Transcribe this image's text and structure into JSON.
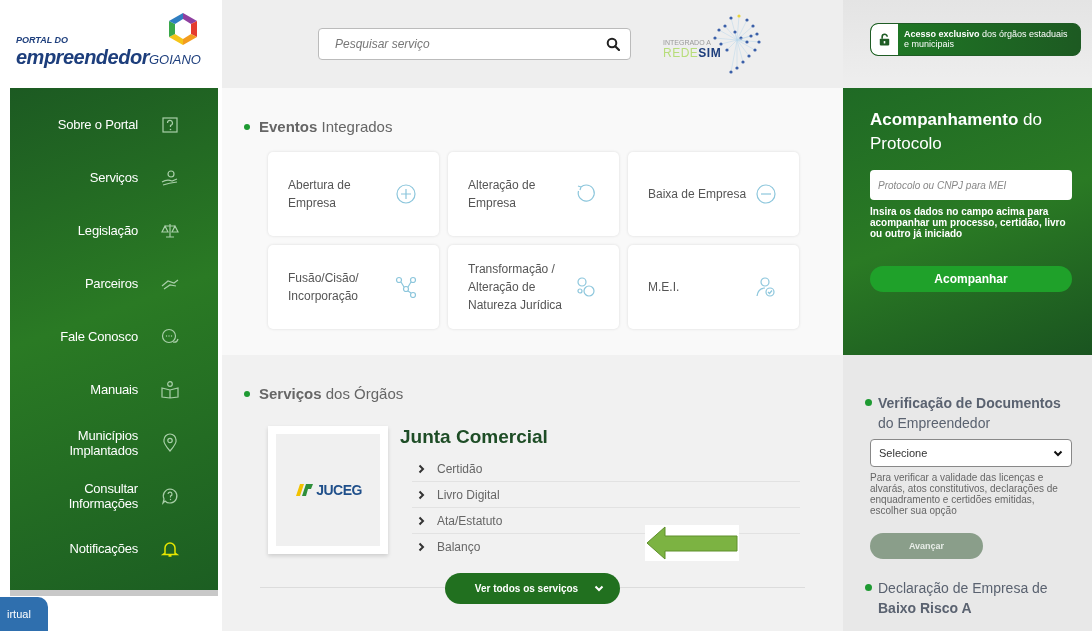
{
  "header": {
    "logo": {
      "top": "PORTAL DO",
      "main": "empreendedor",
      "suffix": "GOIANO"
    },
    "search": {
      "placeholder": "Pesquisar serviço"
    },
    "partner_logo": {
      "caption": "INTEGRADO A",
      "name_light": "REDE",
      "name_bold": "SIM"
    },
    "access_button": "**Acesso exclusivo** dos órgãos estaduais e municipais"
  },
  "sidebar": {
    "items": [
      {
        "label": "Sobre o Portal",
        "highlighted": false
      },
      {
        "label": "Serviços",
        "highlighted": false
      },
      {
        "label": "Legislação",
        "highlighted": false
      },
      {
        "label": "Parceiros",
        "highlighted": false
      },
      {
        "label": "Fale Conosco",
        "highlighted": false
      },
      {
        "label": "Manuais",
        "highlighted": false
      },
      {
        "label": "Municípios Implantados",
        "highlighted": false
      },
      {
        "label": "Consultar Informações",
        "highlighted": false
      },
      {
        "label": "Notificações",
        "highlighted": true
      }
    ]
  },
  "chat_button": "irtual",
  "events": {
    "title": "**Eventos** Integrados",
    "cards": [
      {
        "label": "Abertura de Empresa"
      },
      {
        "label": "Alteração de Empresa"
      },
      {
        "label": "Baixa de Empresa"
      },
      {
        "label": "Fusão/Cisão/ Incorporação"
      },
      {
        "label": "Transformação / Alteração de Natureza Jurídica"
      },
      {
        "label": "M.E.I."
      }
    ]
  },
  "services": {
    "title": "**Serviços** dos Órgãos",
    "organ": {
      "name": "Junta Comercial",
      "logo_text": "JUCEG",
      "links": [
        "Certidão",
        "Livro Digital",
        "Ata/Estatuto",
        "Balanço"
      ]
    },
    "more_button": "Ver todos os serviços"
  },
  "protocol": {
    "title": "**Acompanhamento** do Protocolo",
    "placeholder": "Protocolo ou CNPJ para MEI",
    "help": "Insira os dados no campo acima para acompanhar um processo, certidão, livro ou outro já iniciado",
    "button": "Acompanhar"
  },
  "verification": {
    "title": "**Verificação de Documentos** do Empreendedor",
    "select": "Selecione",
    "help": "Para verificar a validade das licenças e alvarás, atos constitutivos, declarações de enquadramento e certidões emitidas, escolher sua opção",
    "button": {
      "label": "Avançar",
      "disabled": true
    }
  },
  "declaration": {
    "title": "Declaração de Empresa de **Baixo Risco A**"
  }
}
